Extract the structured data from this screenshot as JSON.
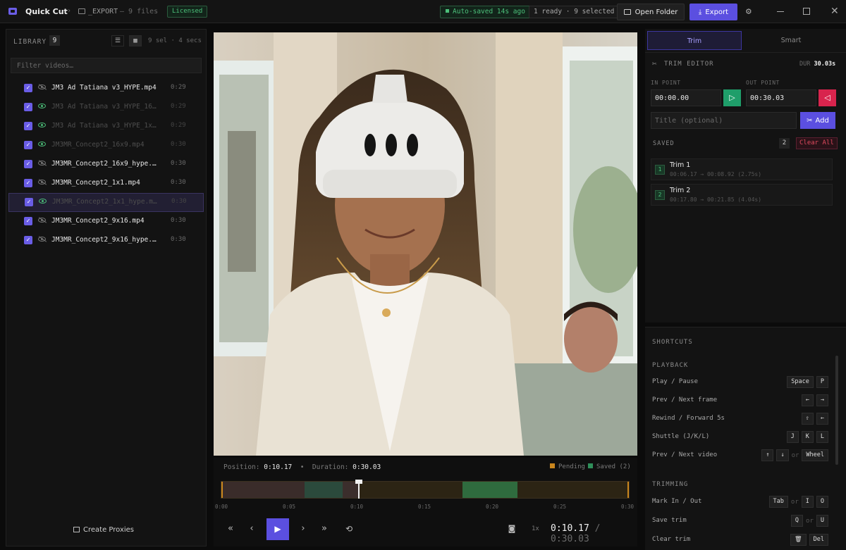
{
  "titlebar": {
    "app_name": "Quick Cut",
    "sep": "›",
    "folder": "_EXPORT",
    "file_count": "— 9 files",
    "license": "Licensed",
    "autosave": "Auto-saved 14s ago",
    "ready": "1 ready · 9 selected",
    "open_folder": "Open Folder",
    "export": "Export"
  },
  "library": {
    "title": "LIBRARY",
    "count": "9",
    "selection_info": "9 sel · 4 secs",
    "filter_placeholder": "Filter videos…",
    "items": [
      {
        "name": "JM3 Ad Tatiana v3_HYPE.mp4",
        "duration": "0:29",
        "eye": "off",
        "dim": false
      },
      {
        "name": "JM3 Ad Tatiana v3_HYPE_16x9.mp4",
        "duration": "0:29",
        "eye": "on",
        "dim": true
      },
      {
        "name": "JM3 Ad Tatiana v3_HYPE_1x1.mp4",
        "duration": "0:29",
        "eye": "on",
        "dim": true
      },
      {
        "name": "JM3MR_Concept2_16x9.mp4",
        "duration": "0:30",
        "eye": "on",
        "dim": true
      },
      {
        "name": "JM3MR_Concept2_16x9_hype.mp4",
        "duration": "0:30",
        "eye": "off",
        "dim": false
      },
      {
        "name": "JM3MR_Concept2_1x1.mp4",
        "duration": "0:30",
        "eye": "off",
        "dim": false
      },
      {
        "name": "JM3MR_Concept2_1x1_hype.mp4",
        "duration": "0:30",
        "eye": "on",
        "dim": true,
        "selected": true
      },
      {
        "name": "JM3MR_Concept2_9x16.mp4",
        "duration": "0:30",
        "eye": "off",
        "dim": false
      },
      {
        "name": "JM3MR_Concept2_9x16_hype.mp4",
        "duration": "0:30",
        "eye": "off",
        "dim": false
      }
    ],
    "create_proxies": "Create Proxies"
  },
  "player": {
    "position_label": "Position:",
    "position": "0:10.17",
    "bullet": "•",
    "duration_label": "Duration:",
    "duration": "0:30.03",
    "legend_pending": "Pending",
    "legend_saved": "Saved (2)",
    "ticks": [
      "0:00",
      "0:05",
      "0:10",
      "0:15",
      "0:20",
      "0:25",
      "0:30"
    ],
    "speed": "1x",
    "current_time": "0:10.17",
    "slash": "/",
    "total_time": "0:30.03"
  },
  "tabs": {
    "trim": "Trim",
    "smart": "Smart"
  },
  "trim_editor": {
    "title": "TRIM EDITOR",
    "dur_label": "DUR",
    "dur_value": "30.03s",
    "in_label": "IN POINT",
    "out_label": "OUT POINT",
    "in_value": "00:00.00",
    "out_value": "00:30.03",
    "title_placeholder": "Title (optional)",
    "add": "Add",
    "saved_label": "SAVED",
    "saved_count": "2",
    "clear_all": "Clear All",
    "trims": [
      {
        "num": "1",
        "name": "Trim 1",
        "range": "00:06.17 → 00:08.92 (2.75s)"
      },
      {
        "num": "2",
        "name": "Trim 2",
        "range": "00:17.80 → 00:21.85 (4.04s)"
      }
    ]
  },
  "shortcuts": {
    "title": "SHORTCUTS",
    "playback_title": "PLAYBACK",
    "playback": [
      {
        "label": "Play / Pause",
        "keys": [
          "Space",
          "P"
        ]
      },
      {
        "label": "Prev / Next frame",
        "keys": [
          "←",
          "→"
        ]
      },
      {
        "label": "Rewind / Forward 5s",
        "keys": [
          "⇧",
          "←"
        ]
      },
      {
        "label": "Shuttle (J/K/L)",
        "keys": [
          "J",
          "K",
          "L"
        ]
      },
      {
        "label": "Prev / Next video",
        "keys": [
          "↑",
          "↓",
          "or",
          "Wheel"
        ]
      }
    ],
    "trimming_title": "TRIMMING",
    "trimming": [
      {
        "label": "Mark In / Out",
        "keys": [
          "Tab",
          "or",
          "I",
          "O"
        ]
      },
      {
        "label": "Save trim",
        "keys": [
          "Q",
          "or",
          "U"
        ]
      },
      {
        "label": "Clear trim",
        "keys": [
          "🗑",
          "Del"
        ]
      }
    ]
  },
  "colors": {
    "accent": "#5b4fe0",
    "saved": "#2f8f5a",
    "pending": "#c9861d",
    "out_mark": "#d8244d",
    "in_mark": "#1f9e6a"
  }
}
